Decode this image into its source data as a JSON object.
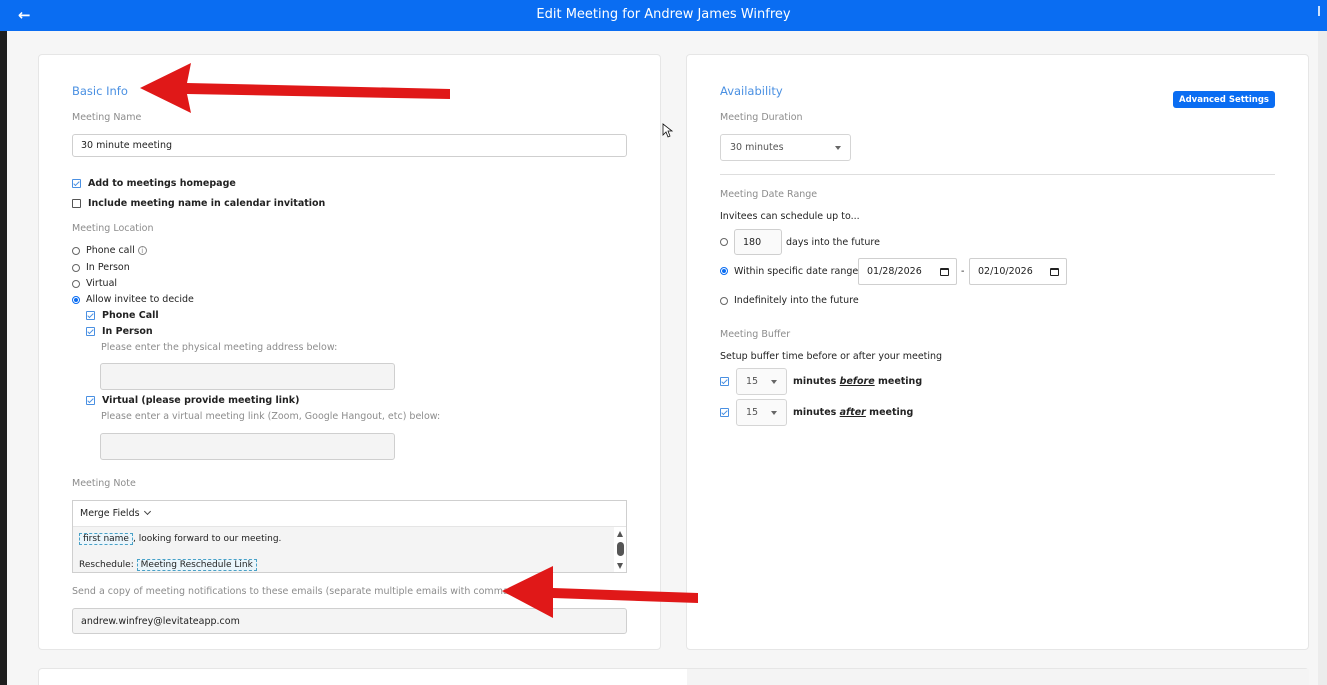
{
  "header": {
    "title": "Edit Meeting for Andrew James Winfrey",
    "back_icon": "arrow-left-icon"
  },
  "basic_info": {
    "section_title": "Basic Info",
    "meeting_name_label": "Meeting Name",
    "meeting_name_value": "30 minute meeting",
    "add_to_homepage": {
      "label": "Add to meetings homepage",
      "checked": true
    },
    "include_in_invitation": {
      "label": "Include meeting name in calendar invitation",
      "checked": false
    },
    "location_label": "Meeting Location",
    "location_options": [
      {
        "label": "Phone call",
        "selected": false
      },
      {
        "label": "In Person",
        "selected": false
      },
      {
        "label": "Virtual",
        "selected": false
      },
      {
        "label": "Allow invitee to decide",
        "selected": true
      }
    ],
    "sub_options": {
      "phone": {
        "label": "Phone Call",
        "checked": true
      },
      "in_person": {
        "label": "In Person",
        "checked": true
      },
      "address_hint": "Please enter the physical meeting address below:",
      "address_value": "",
      "virtual": {
        "label": "Virtual (please provide meeting link)",
        "checked": true
      },
      "link_hint": "Please enter a virtual meeting link (Zoom, Google Hangout, etc) below:",
      "link_value": ""
    },
    "note_label": "Meeting Note",
    "merge_fields_label": "Merge Fields",
    "note_line1_tag": "first name",
    "note_line1_text": ", looking forward to our meeting.",
    "note_line2_prefix": "Reschedule:",
    "note_line2_tag": "Meeting Reschedule Link",
    "copy_emails_label": "Send a copy of meeting notifications to these emails (separate multiple emails with commas)",
    "copy_emails_value": "andrew.winfrey@levitateapp.com"
  },
  "availability": {
    "section_title": "Availability",
    "advanced_button": "Advanced Settings",
    "duration_label": "Meeting Duration",
    "duration_value": "30 minutes",
    "date_range_label": "Meeting Date Range",
    "date_range_sub": "Invitees can schedule up to...",
    "days_value": "180",
    "days_suffix": "days into the future",
    "specific_label": "Within specific date range",
    "start_date": "01/28/2026",
    "date_sep": "-",
    "end_date": "02/10/2026",
    "indefinite_label": "Indefinitely into the future",
    "selected_range": "specific",
    "buffer_label": "Meeting Buffer",
    "buffer_sub": "Setup buffer time before or after your meeting",
    "buffer_before": {
      "value": "15",
      "label_prefix": "minutes ",
      "label_em": "before",
      "label_suffix": " meeting",
      "checked": true
    },
    "buffer_after": {
      "value": "15",
      "label_prefix": "minutes ",
      "label_em": "after",
      "label_suffix": " meeting",
      "checked": true
    }
  },
  "colors": {
    "header": "#0a6df2",
    "section_title": "#4a90e2",
    "annotation_arrow": "#e01818"
  }
}
